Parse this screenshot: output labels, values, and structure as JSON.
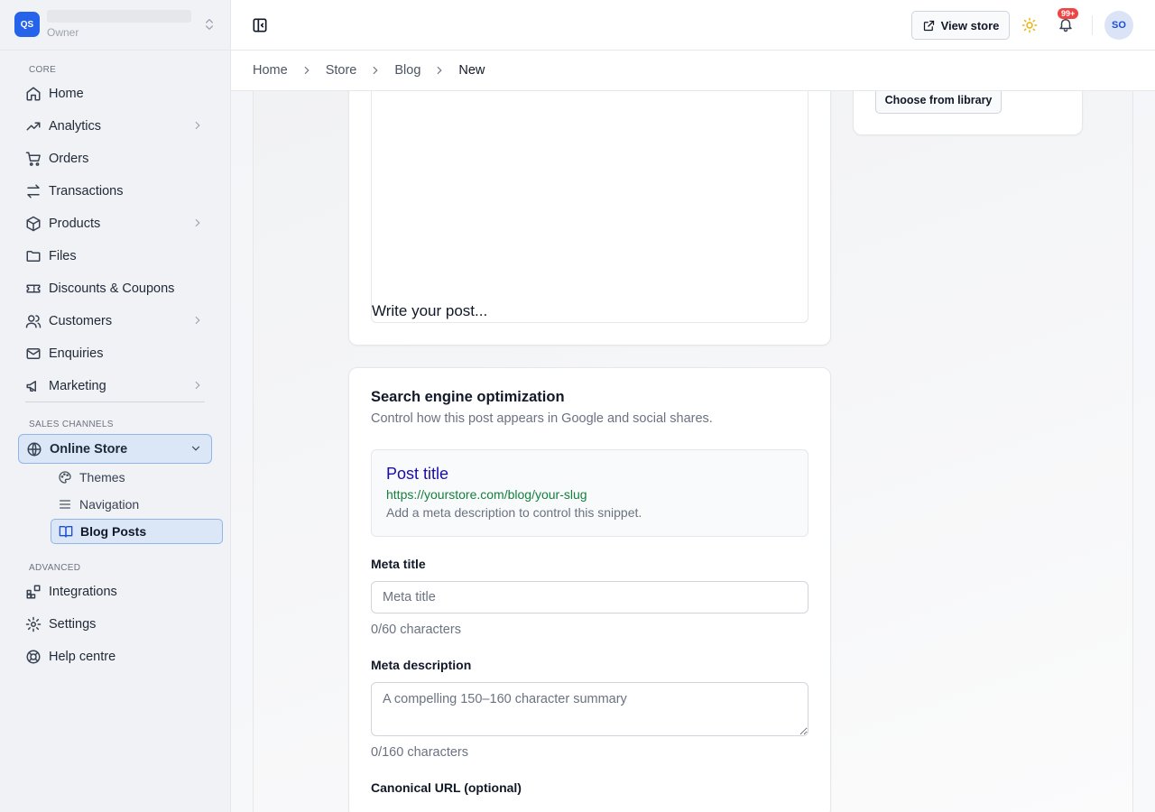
{
  "store": {
    "logo_text": "QS",
    "role": "Owner"
  },
  "sidebar": {
    "core_label": "CORE",
    "core_items": [
      {
        "label": "Home"
      },
      {
        "label": "Analytics"
      },
      {
        "label": "Orders"
      },
      {
        "label": "Transactions"
      },
      {
        "label": "Products"
      },
      {
        "label": "Files"
      },
      {
        "label": "Discounts & Coupons"
      },
      {
        "label": "Customers"
      },
      {
        "label": "Enquiries"
      },
      {
        "label": "Marketing"
      }
    ],
    "sales_label": "SALES CHANNELS",
    "online_store": "Online Store",
    "sub_items": [
      {
        "label": "Themes"
      },
      {
        "label": "Navigation"
      },
      {
        "label": "Blog Posts"
      }
    ],
    "advanced_label": "ADVANCED",
    "advanced_items": [
      {
        "label": "Integrations"
      },
      {
        "label": "Settings"
      },
      {
        "label": "Help centre"
      }
    ]
  },
  "header": {
    "view_store": "View store",
    "badge": "99+",
    "avatar": "SO"
  },
  "breadcrumb": [
    "Home",
    "Store",
    "Blog",
    "New"
  ],
  "editor": {
    "placeholder": "Write your post..."
  },
  "media": {
    "library_button": "Choose from library"
  },
  "seo": {
    "title": "Search engine optimization",
    "subtitle": "Control how this post appears in Google and social shares.",
    "snippet": {
      "title": "Post title",
      "url": "https://yourstore.com/blog/your-slug",
      "description": "Add a meta description to control this snippet."
    },
    "meta_title_label": "Meta title",
    "meta_title_placeholder": "Meta title",
    "meta_title_counter": "0/60 characters",
    "meta_desc_label": "Meta description",
    "meta_desc_placeholder": "A compelling 150–160 character summary",
    "meta_desc_counter": "0/160 characters",
    "canonical_label": "Canonical URL (optional)"
  },
  "colors": {
    "accent": "#2563eb",
    "active_bg": "#dbe6f7",
    "badge": "#ef4444",
    "snippet_title": "#1a0dab",
    "snippet_url": "#15803d"
  }
}
